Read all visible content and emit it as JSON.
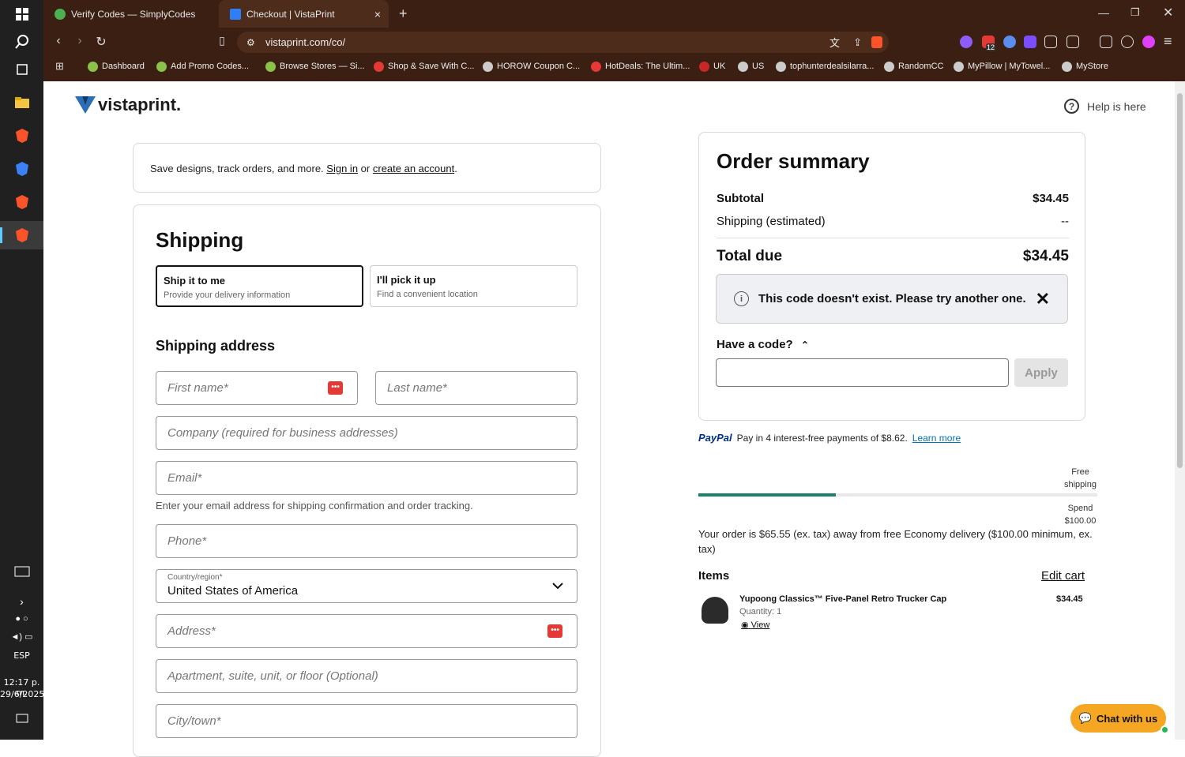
{
  "taskbar": {
    "lang": "ESP",
    "time": "12:17 p. m.",
    "date": "29/6/2025"
  },
  "browser": {
    "tabs": [
      {
        "label": "Verify Codes — SimplyCodes"
      },
      {
        "label": "Checkout | VistaPrint"
      }
    ],
    "url": "vistaprint.com/co/",
    "bookmarks": [
      "Dashboard",
      "Add Promo Codes...",
      "Browse Stores — Si...",
      "Shop & Save With C...",
      "HOROW Coupon C...",
      "HotDeals: The Ultim...",
      "UK",
      "US",
      "tophunterdealsilarra...",
      "RandomCC",
      "MyPillow | MyTowel...",
      "MyStore"
    ],
    "ext_badge": "12"
  },
  "header": {
    "logo": "vistaprint.",
    "help": "Help is here",
    "help_glyph": "?"
  },
  "signin": {
    "text": "Save designs, track orders, and more.",
    "sign_in": "Sign in",
    "or": "or",
    "create": "create an account",
    "end": "."
  },
  "shipping": {
    "title": "Shipping",
    "options": [
      {
        "title": "Ship it to me",
        "sub": "Provide your delivery information",
        "selected": true
      },
      {
        "title": "I'll pick it up",
        "sub": "Find a convenient location",
        "selected": false
      }
    ],
    "address_title": "Shipping address",
    "fields": {
      "first": "First name*",
      "last": "Last name*",
      "company": "Company (required for business addresses)",
      "email": "Email*",
      "phone": "Phone*",
      "address": "Address*",
      "apt": "Apartment, suite, unit, or floor (Optional)",
      "city": "City/town*"
    },
    "email_help": "Enter your email address for shipping confirmation and order tracking.",
    "country_label": "Country/region*",
    "country_value": "United States of America"
  },
  "summary": {
    "title": "Order summary",
    "subtotal_label": "Subtotal",
    "subtotal": "$34.45",
    "shipping_label": "Shipping (estimated)",
    "shipping": "--",
    "total_label": "Total due",
    "total": "$34.45",
    "alert": "This code doesn't exist. Please try another one.",
    "code_label": "Have a code?",
    "apply": "Apply"
  },
  "paypal": {
    "logo": "PayPal",
    "text": "Pay in 4 interest-free payments of $8.62.",
    "link": "Learn more"
  },
  "progress": {
    "fraction": 0.3445,
    "free_label": "Free shipping",
    "spend_label": "Spend $100.00",
    "message": "Your order is $65.55 (ex. tax) away from free Economy delivery ($100.00 minimum, ex. tax)"
  },
  "items": {
    "title": "Items",
    "edit": "Edit cart",
    "list": [
      {
        "name": "Yupoong Classics™ Five-Panel Retro Trucker Cap",
        "qty": "Quantity: 1",
        "view": "View",
        "price": "$34.45"
      }
    ]
  },
  "chat": {
    "label": "Chat with us"
  }
}
